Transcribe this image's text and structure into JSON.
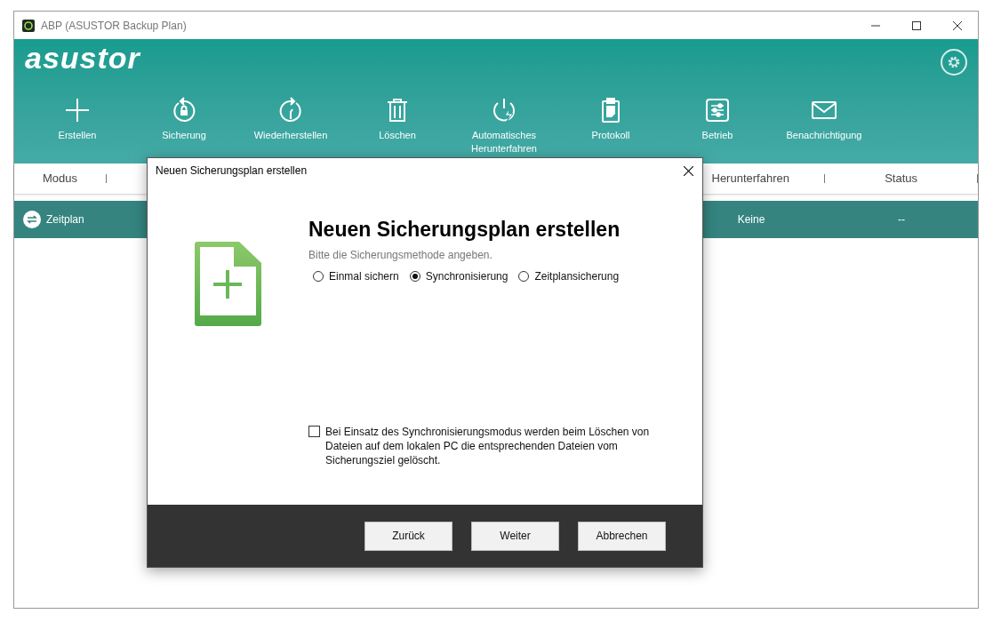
{
  "window": {
    "title": "ABP (ASUSTOR Backup Plan)"
  },
  "header": {
    "logo": "asustor"
  },
  "toolbar": [
    {
      "kind": "plus",
      "label": "Erstellen"
    },
    {
      "kind": "backup",
      "label": "Sicherung"
    },
    {
      "kind": "restore",
      "label": "Wiederherstellen"
    },
    {
      "kind": "trash",
      "label": "Löschen"
    },
    {
      "kind": "power",
      "label": "Automatisches Herunterfahren"
    },
    {
      "kind": "clipboard",
      "label": "Protokoll"
    },
    {
      "kind": "sliders",
      "label": "Betrieb"
    },
    {
      "kind": "mail",
      "label": "Benachrichtigung"
    }
  ],
  "table": {
    "columns": [
      "Modus",
      "Herunterfahren",
      "Status"
    ],
    "rows": [
      {
        "selected": true,
        "cells": [
          "Zeitplan",
          "Keine",
          "--"
        ]
      }
    ]
  },
  "dialog": {
    "title": "Neuen Sicherungsplan erstellen",
    "heading": "Neuen Sicherungsplan erstellen",
    "subtitle": "Bitte die Sicherungsmethode angeben.",
    "methods": [
      {
        "label": "Einmal sichern",
        "selected": false
      },
      {
        "label": "Synchronisierung",
        "selected": true
      },
      {
        "label": "Zeitplansicherung",
        "selected": false
      }
    ],
    "sync_delete": {
      "label": "Bei Einsatz des Synchronisierungsmodus werden beim Löschen von Dateien auf dem lokalen PC die entsprechenden Dateien vom Sicherungsziel gelöscht.",
      "checked": false
    },
    "buttons": [
      "Zurück",
      "Weiter",
      "Abbrechen"
    ]
  }
}
